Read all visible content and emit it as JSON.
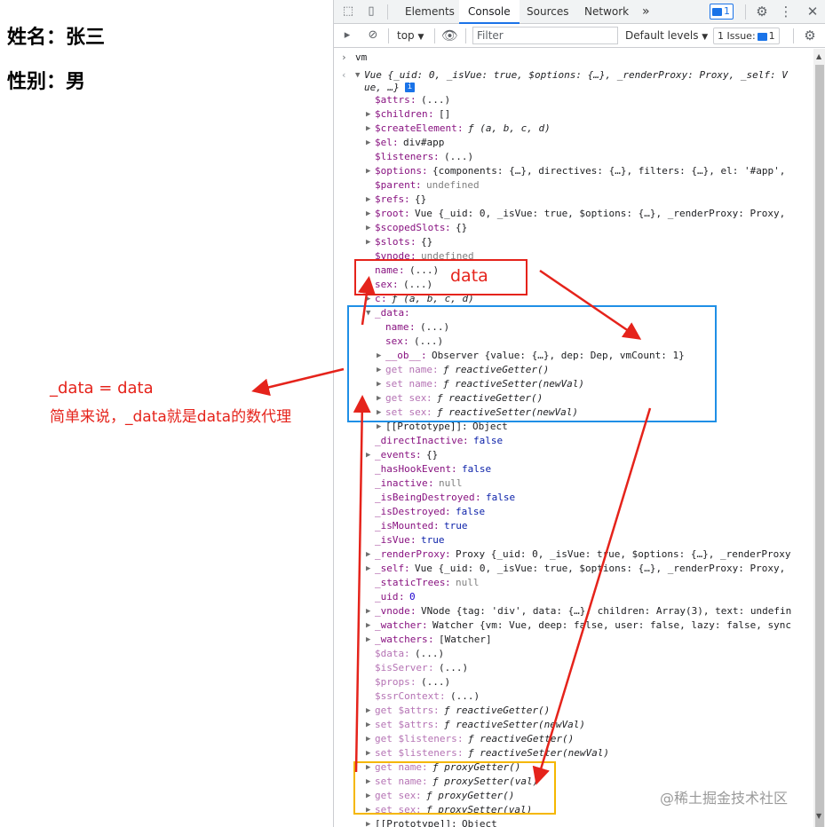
{
  "app": {
    "name_line": "姓名：张三",
    "sex_line": "性别：男"
  },
  "devtools": {
    "tabs": [
      "Elements",
      "Console",
      "Sources",
      "Network"
    ],
    "active_tab": "Console",
    "more_tabs": "»",
    "messages_badge": "1",
    "toolbar": {
      "context": "top",
      "filter_placeholder": "Filter",
      "levels": "Default levels",
      "issues_label": "1 Issue:",
      "issues_count": "1"
    }
  },
  "console": {
    "command": "vm",
    "result_summary": "Vue {_uid: 0, _isVue: true, $options: {…}, _renderProxy: Proxy, _self: V",
    "result_summary_cont": "ue, …}",
    "properties": [
      {
        "key": "$attrs",
        "value": "(...)",
        "expandable": false,
        "style": "key"
      },
      {
        "key": "$children",
        "value": "[]",
        "expandable": true,
        "style": "key"
      },
      {
        "key": "$createElement",
        "value": "ƒ (a, b, c, d)",
        "expandable": true,
        "style": "key"
      },
      {
        "key": "$el",
        "value": "div#app",
        "expandable": true,
        "style": "key"
      },
      {
        "key": "$listeners",
        "value": "(...)",
        "expandable": false,
        "style": "key"
      },
      {
        "key": "$options",
        "value": "{components: {…}, directives: {…}, filters: {…}, el: '#app',",
        "expandable": true,
        "style": "key"
      },
      {
        "key": "$parent",
        "value": "undefined",
        "expandable": false,
        "style": "key"
      },
      {
        "key": "$refs",
        "value": "{}",
        "expandable": true,
        "style": "key"
      },
      {
        "key": "$root",
        "value": "Vue {_uid: 0, _isVue: true, $options: {…}, _renderProxy: Proxy,",
        "expandable": true,
        "style": "key"
      },
      {
        "key": "$scopedSlots",
        "value": "{}",
        "expandable": true,
        "style": "key"
      },
      {
        "key": "$slots",
        "value": "{}",
        "expandable": true,
        "style": "key"
      },
      {
        "key": "$vnode",
        "value": "undefined",
        "expandable": false,
        "style": "key"
      },
      {
        "key": "name",
        "value": "(...)",
        "expandable": false,
        "style": "key"
      },
      {
        "key": "sex",
        "value": "(...)",
        "expandable": false,
        "style": "key"
      },
      {
        "key": "c",
        "value": "ƒ (a, b, c, d)",
        "expandable": true,
        "style": "key"
      },
      {
        "key": "_data",
        "value": "",
        "expandable": true,
        "style": "key",
        "open": true
      },
      {
        "key": "name",
        "value": "(...)",
        "expandable": false,
        "style": "key",
        "indent": 1
      },
      {
        "key": "sex",
        "value": "(...)",
        "expandable": false,
        "style": "key",
        "indent": 1
      },
      {
        "key": "__ob__",
        "value": "Observer {value: {…}, dep: Dep, vmCount: 1}",
        "expandable": true,
        "style": "key",
        "indent": 1
      },
      {
        "key": "get name",
        "value": "ƒ reactiveGetter()",
        "expandable": true,
        "style": "dim",
        "indent": 1
      },
      {
        "key": "set name",
        "value": "ƒ reactiveSetter(newVal)",
        "expandable": true,
        "style": "dim",
        "indent": 1
      },
      {
        "key": "get sex",
        "value": "ƒ reactiveGetter()",
        "expandable": true,
        "style": "dim",
        "indent": 1
      },
      {
        "key": "set sex",
        "value": "ƒ reactiveSetter(newVal)",
        "expandable": true,
        "style": "dim",
        "indent": 1
      },
      {
        "key": "[[Prototype]]",
        "value": "Object",
        "expandable": true,
        "style": "plain",
        "indent": 1
      },
      {
        "key": "_directInactive",
        "value": "false",
        "expandable": false,
        "style": "key"
      },
      {
        "key": "_events",
        "value": "{}",
        "expandable": true,
        "style": "key"
      },
      {
        "key": "_hasHookEvent",
        "value": "false",
        "expandable": false,
        "style": "key"
      },
      {
        "key": "_inactive",
        "value": "null",
        "expandable": false,
        "style": "key"
      },
      {
        "key": "_isBeingDestroyed",
        "value": "false",
        "expandable": false,
        "style": "key"
      },
      {
        "key": "_isDestroyed",
        "value": "false",
        "expandable": false,
        "style": "key"
      },
      {
        "key": "_isMounted",
        "value": "true",
        "expandable": false,
        "style": "key"
      },
      {
        "key": "_isVue",
        "value": "true",
        "expandable": false,
        "style": "key"
      },
      {
        "key": "_renderProxy",
        "value": "Proxy {_uid: 0, _isVue: true, $options: {…}, _renderProxy",
        "expandable": true,
        "style": "key"
      },
      {
        "key": "_self",
        "value": "Vue {_uid: 0, _isVue: true, $options: {…}, _renderProxy: Proxy,",
        "expandable": true,
        "style": "key"
      },
      {
        "key": "_staticTrees",
        "value": "null",
        "expandable": false,
        "style": "key"
      },
      {
        "key": "_uid",
        "value": "0",
        "expandable": false,
        "style": "key"
      },
      {
        "key": "_vnode",
        "value": "VNode {tag: 'div', data: {…}, children: Array(3), text: undefin",
        "expandable": true,
        "style": "key"
      },
      {
        "key": "_watcher",
        "value": "Watcher {vm: Vue, deep: false, user: false, lazy: false, sync",
        "expandable": true,
        "style": "key"
      },
      {
        "key": "_watchers",
        "value": "[Watcher]",
        "expandable": true,
        "style": "key"
      },
      {
        "key": "$data",
        "value": "(...)",
        "expandable": false,
        "style": "dim"
      },
      {
        "key": "$isServer",
        "value": "(...)",
        "expandable": false,
        "style": "dim"
      },
      {
        "key": "$props",
        "value": "(...)",
        "expandable": false,
        "style": "dim"
      },
      {
        "key": "$ssrContext",
        "value": "(...)",
        "expandable": false,
        "style": "dim"
      },
      {
        "key": "get $attrs",
        "value": "ƒ reactiveGetter()",
        "expandable": true,
        "style": "dim"
      },
      {
        "key": "set $attrs",
        "value": "ƒ reactiveSetter(newVal)",
        "expandable": true,
        "style": "dim"
      },
      {
        "key": "get $listeners",
        "value": "ƒ reactiveGetter()",
        "expandable": true,
        "style": "dim"
      },
      {
        "key": "set $listeners",
        "value": "ƒ reactiveSetter(newVal)",
        "expandable": true,
        "style": "dim"
      },
      {
        "key": "get name",
        "value": "ƒ proxyGetter()",
        "expandable": true,
        "style": "dim"
      },
      {
        "key": "set name",
        "value": "ƒ proxySetter(val)",
        "expandable": true,
        "style": "dim"
      },
      {
        "key": "get sex",
        "value": "ƒ proxyGetter()",
        "expandable": true,
        "style": "dim"
      },
      {
        "key": "set sex",
        "value": "ƒ proxySetter(val)",
        "expandable": true,
        "style": "dim"
      },
      {
        "key": "[[Prototype]]",
        "value": "Object",
        "expandable": true,
        "style": "plain"
      }
    ]
  },
  "annotations": {
    "data_label": "data",
    "equation": "_data = data",
    "explanation": "简单来说，_data就是data的数代理",
    "colors": {
      "red": "#e5231b",
      "blue": "#1f8fe6",
      "orange": "#f5b700"
    }
  },
  "watermark": "@稀土掘金技术社区"
}
